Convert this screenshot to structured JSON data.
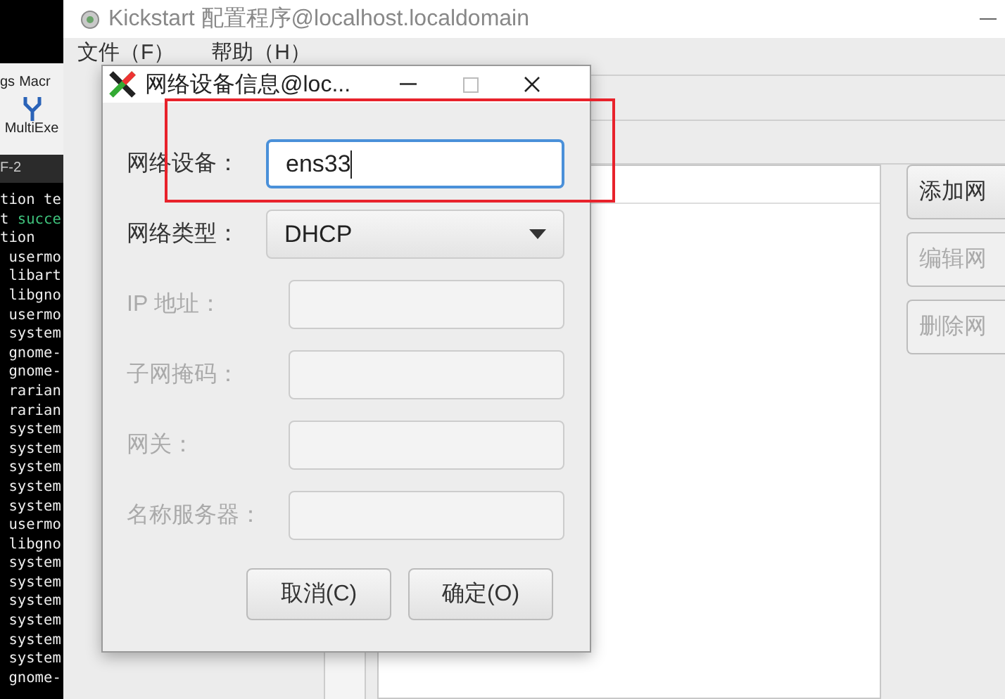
{
  "side_toolbar": {
    "items": [
      "gs",
      "Macr"
    ],
    "tool": "MultiExe"
  },
  "terminal": {
    "tab": "F-2",
    "lines": [
      {
        "text": "tion te"
      },
      {
        "text": "t ",
        "accent": "succe"
      },
      {
        "text": "tion"
      },
      {
        "text": " usermo"
      },
      {
        "text": " libart"
      },
      {
        "text": " libgno"
      },
      {
        "text": " usermo"
      },
      {
        "text": " system"
      },
      {
        "text": " gnome-"
      },
      {
        "text": " gnome-"
      },
      {
        "text": " rarian"
      },
      {
        "text": " rarian"
      },
      {
        "text": " system"
      },
      {
        "text": " system"
      },
      {
        "text": " system"
      },
      {
        "text": " system"
      },
      {
        "text": " system"
      },
      {
        "text": " usermo"
      },
      {
        "text": " libgno"
      },
      {
        "text": " system"
      },
      {
        "text": " system"
      },
      {
        "text": " system"
      },
      {
        "text": " system"
      },
      {
        "text": " system"
      },
      {
        "text": " system"
      },
      {
        "text": " gnome-"
      }
    ]
  },
  "main_window": {
    "title": "Kickstart 配置程序@localhost.localdomain",
    "menu": [
      "文件（F）",
      "帮助（H）"
    ],
    "buttons": [
      {
        "label": "添加网",
        "disabled": false
      },
      {
        "label": "编辑网",
        "disabled": true
      },
      {
        "label": "删除网",
        "disabled": true
      }
    ]
  },
  "dialog": {
    "title": "网络设备信息@loc...",
    "fields": [
      {
        "kind": "text",
        "label": "网络设备：",
        "value": "ens33",
        "disabled": false,
        "focused": true
      },
      {
        "kind": "combo",
        "label": "网络类型：",
        "value": "DHCP",
        "disabled": false,
        "focused": false
      },
      {
        "kind": "text",
        "label": "IP 地址：",
        "disabled": true,
        "focused": false
      },
      {
        "kind": "text",
        "label": "子网掩码：",
        "disabled": true,
        "focused": false
      },
      {
        "kind": "text",
        "label": "网关：",
        "disabled": true,
        "focused": false
      },
      {
        "kind": "text",
        "label": "名称服务器：",
        "disabled": true,
        "focused": false
      }
    ],
    "buttons": [
      "取消(C)",
      "确定(O)"
    ]
  }
}
